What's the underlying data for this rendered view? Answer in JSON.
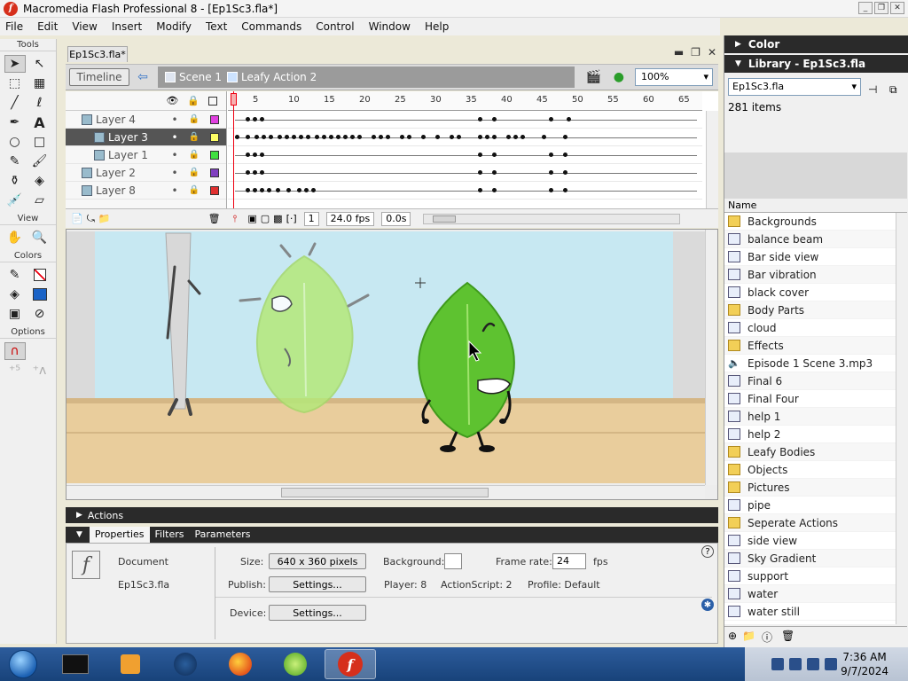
{
  "window": {
    "title": "Macromedia Flash Professional 8 - [Ep1Sc3.fla*]"
  },
  "menu": [
    "File",
    "Edit",
    "View",
    "Insert",
    "Modify",
    "Text",
    "Commands",
    "Control",
    "Window",
    "Help"
  ],
  "tools": {
    "title": "Tools",
    "view_title": "View",
    "colors_title": "Colors",
    "options_title": "Options"
  },
  "document": {
    "tab": "Ep1Sc3.fla*"
  },
  "timeline_bar": {
    "timeline_button": "Timeline",
    "scene": "Scene 1",
    "symbol": "Leafy Action 2",
    "zoom": "100%"
  },
  "timeline": {
    "ruler": [
      "5",
      "10",
      "15",
      "20",
      "25",
      "30",
      "35",
      "40",
      "45",
      "50",
      "55",
      "60",
      "65"
    ],
    "layers": [
      {
        "name": "Layer 4",
        "color": "#e040e0",
        "selected": false,
        "indent": false
      },
      {
        "name": "Layer 3",
        "color": "#ffff66",
        "selected": true,
        "indent": true
      },
      {
        "name": "Layer 1",
        "color": "#40e040",
        "selected": false,
        "indent": true
      },
      {
        "name": "Layer 2",
        "color": "#8040c0",
        "selected": false,
        "indent": false
      },
      {
        "name": "Layer 8",
        "color": "#e03030",
        "selected": false,
        "indent": false
      }
    ],
    "current_frame": "1",
    "fps": "24.0 fps",
    "elapsed": "0.0s"
  },
  "actions_panel": {
    "label": "Actions"
  },
  "properties": {
    "tabs": [
      "Properties",
      "Filters",
      "Parameters"
    ],
    "type": "Document",
    "doc_name": "Ep1Sc3.fla",
    "size_label": "Size:",
    "size_value": "640 x 360 pixels",
    "background_label": "Background:",
    "frame_rate_label": "Frame rate:",
    "frame_rate_value": "24",
    "fps_unit": "fps",
    "publish_label": "Publish:",
    "settings_button": "Settings...",
    "player_label": "Player: 8",
    "actionscript_label": "ActionScript: 2",
    "profile_label": "Profile: Default",
    "device_label": "Device:",
    "device_settings_button": "Settings..."
  },
  "color_panel": {
    "label": "Color"
  },
  "library": {
    "title": "Library - Ep1Sc3.fla",
    "selected_doc": "Ep1Sc3.fla",
    "count": "281 items",
    "column_name": "Name",
    "items": [
      {
        "name": "Backgrounds",
        "type": "folder"
      },
      {
        "name": "balance beam",
        "type": "symbol"
      },
      {
        "name": "Bar side view",
        "type": "symbol"
      },
      {
        "name": "Bar vibration",
        "type": "symbol"
      },
      {
        "name": "black cover",
        "type": "symbol"
      },
      {
        "name": "Body Parts",
        "type": "folder"
      },
      {
        "name": "cloud",
        "type": "symbol"
      },
      {
        "name": "Effects",
        "type": "folder"
      },
      {
        "name": "Episode 1 Scene 3.mp3",
        "type": "sound"
      },
      {
        "name": "Final 6",
        "type": "symbol"
      },
      {
        "name": "Final Four",
        "type": "symbol"
      },
      {
        "name": "help 1",
        "type": "symbol"
      },
      {
        "name": "help 2",
        "type": "symbol"
      },
      {
        "name": "Leafy Bodies",
        "type": "folder"
      },
      {
        "name": "Objects",
        "type": "folder"
      },
      {
        "name": "Pictures",
        "type": "folder"
      },
      {
        "name": "pipe",
        "type": "symbol"
      },
      {
        "name": "Seperate Actions",
        "type": "folder"
      },
      {
        "name": "side view",
        "type": "symbol"
      },
      {
        "name": "Sky Gradient",
        "type": "symbol"
      },
      {
        "name": "support",
        "type": "symbol"
      },
      {
        "name": "water",
        "type": "symbol"
      },
      {
        "name": "water still",
        "type": "symbol"
      }
    ]
  },
  "taskbar": {
    "time": "7:36 AM",
    "date": "9/7/2024"
  },
  "colors": {
    "stage_sky": "#c7e8f2",
    "stage_floor": "#e9cd9c",
    "leaf_green": "#5ec230",
    "leaf_light": "#b5e87a",
    "playhead": "#e01111"
  }
}
